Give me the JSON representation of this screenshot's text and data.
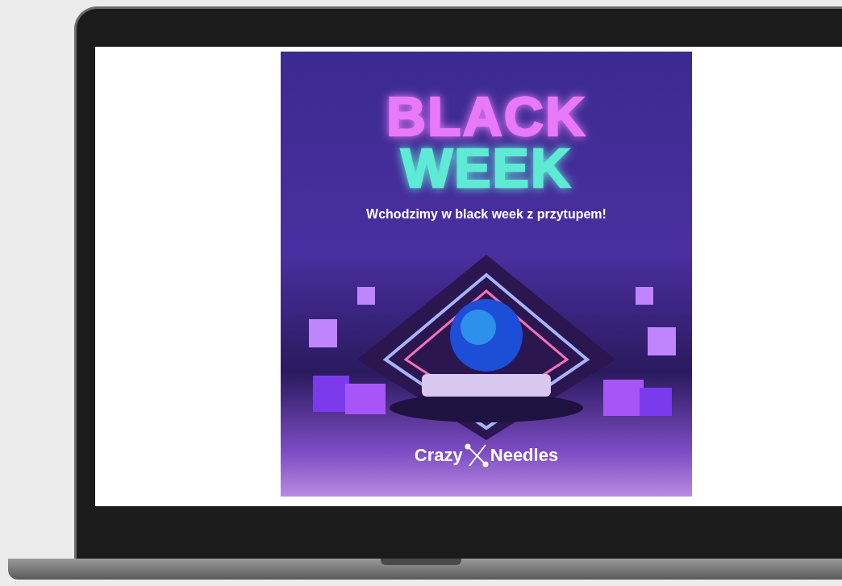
{
  "banner": {
    "headline": [
      {
        "text": "BLACK",
        "color": "#e879f9"
      },
      {
        "text": "WEEK",
        "color": "#5eead4"
      }
    ],
    "tagline": "Wchodzimy w black week z przytupem!",
    "logo": {
      "left": "Crazy",
      "right": "Needles"
    }
  }
}
